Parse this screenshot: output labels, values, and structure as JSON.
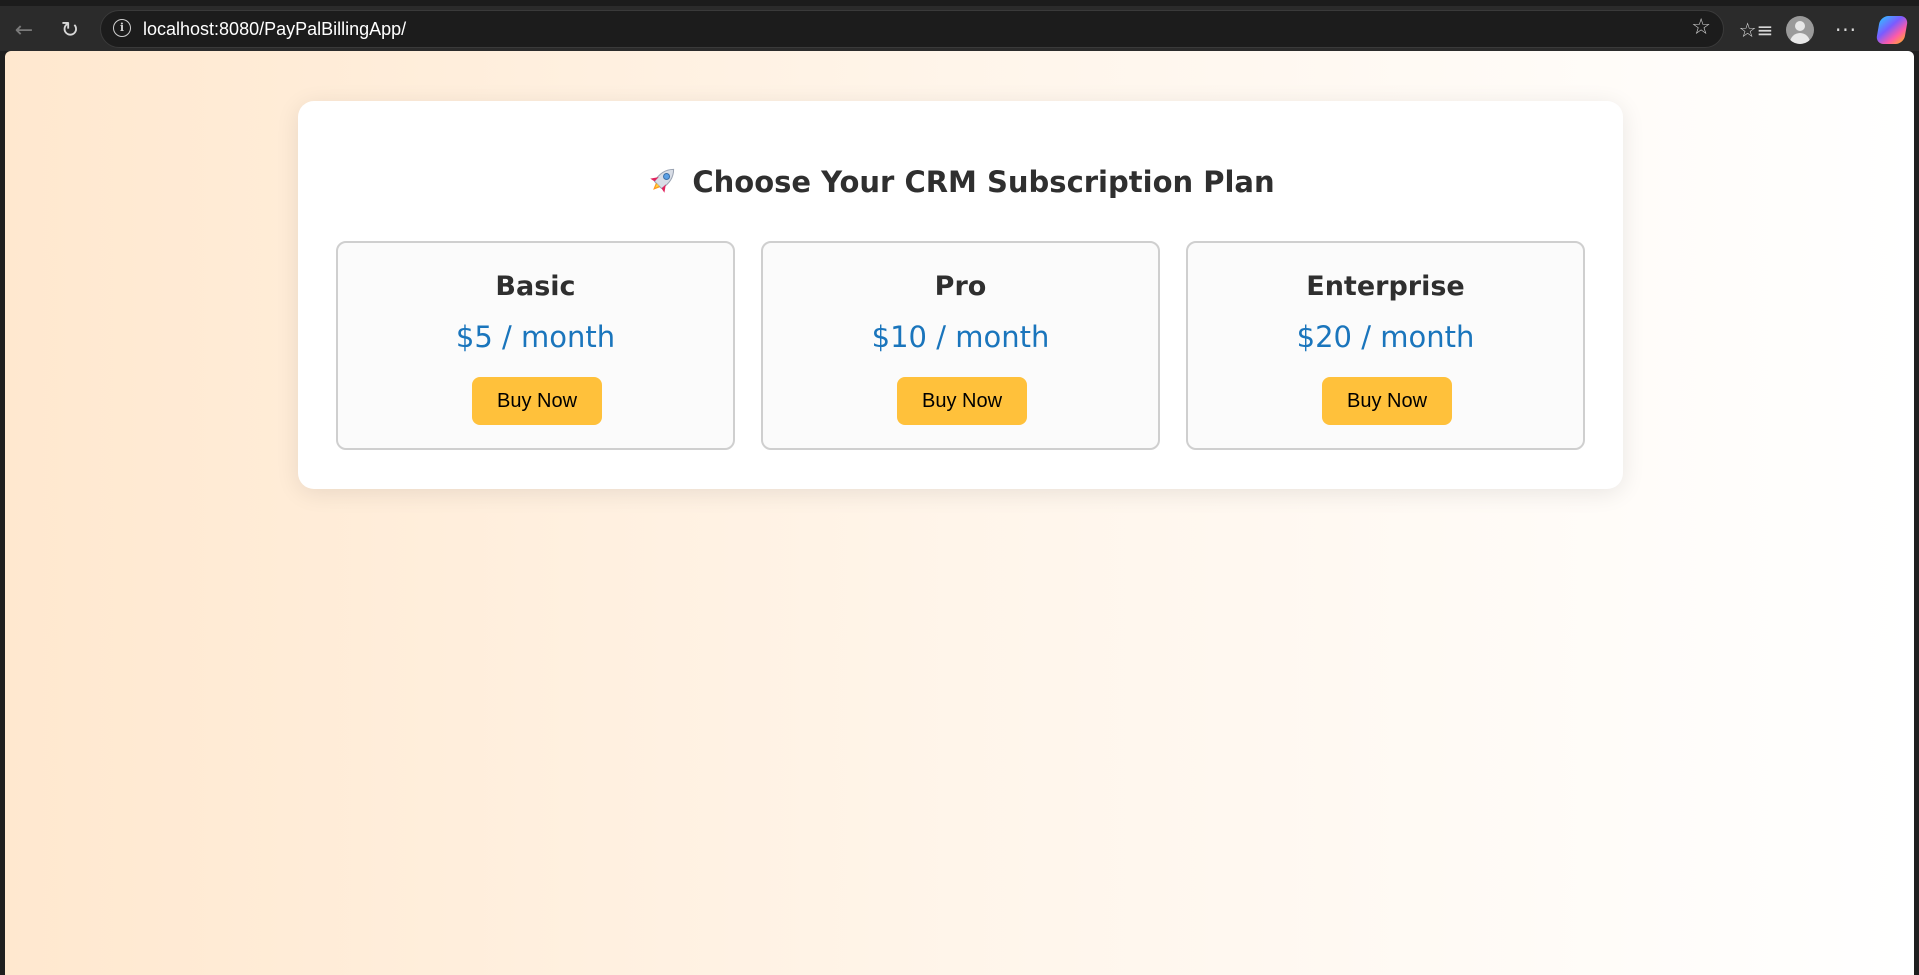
{
  "browser": {
    "url": "localhost:8080/PayPalBillingApp/",
    "icons": [
      "back-icon",
      "reload-icon",
      "info-icon",
      "star-icon",
      "favorites-icon",
      "profile-icon",
      "more-icon",
      "copilot-icon"
    ]
  },
  "page": {
    "title": "Choose Your CRM Subscription Plan",
    "title_icon": "rocket-icon",
    "plans": [
      {
        "name": "Basic",
        "price": "$5 / month",
        "button_label": "Buy Now"
      },
      {
        "name": "Pro",
        "price": "$10 / month",
        "button_label": "Buy Now"
      },
      {
        "name": "Enterprise",
        "price": "$20 / month",
        "button_label": "Buy Now"
      }
    ]
  },
  "colors": {
    "price_text": "#1a75bc",
    "button_bg": "#ffc13b",
    "background_gradient_start": "#ffe8cf",
    "background_gradient_end": "#ffffff"
  }
}
